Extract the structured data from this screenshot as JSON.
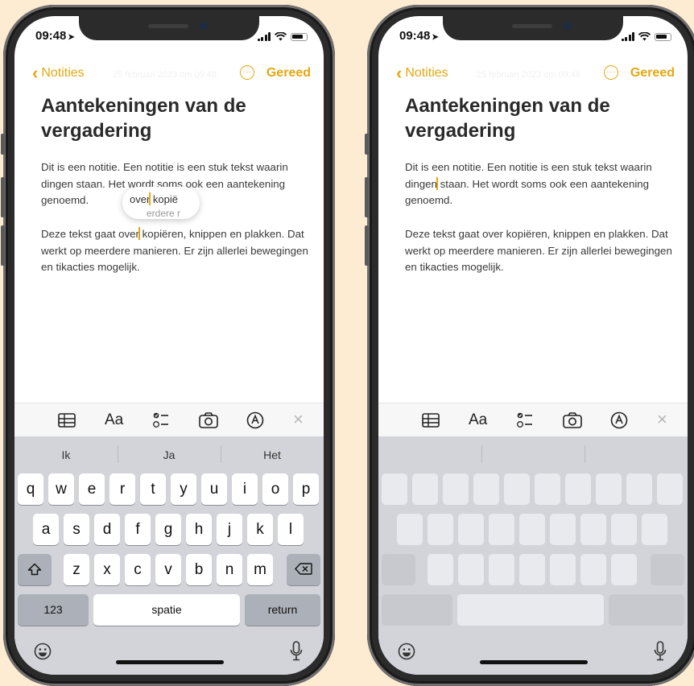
{
  "colors": {
    "accent": "#e6a710",
    "background": "#fdebd2"
  },
  "left_phone": {
    "status": {
      "time": "09:48",
      "location_icon": "location-arrow-icon"
    },
    "nav": {
      "back_label": "Notities",
      "faint_date": "25 februari 2023 om 09:48",
      "done_label": "Gereed"
    },
    "note": {
      "title": "Aantekeningen van de vergadering",
      "p1_a": "Dit is een notitie. Een notitie is een stuk tekst waarin dingen staan. Het wordt soms ook een aantekening ge",
      "p1_b": "noemd.",
      "p2_a": "Deze tekst gaat over",
      "p2_b": " kopiëren, knippen en plakken. Dat werkt op meerdere manieren. Er zijn allerlei bewegingen en tikacties mogelijk."
    },
    "magnifier": {
      "line1_a": "over",
      "line1_b": " kopië",
      "line2": "erdere r"
    },
    "toolbar": {
      "format_label": "Aa"
    },
    "suggestions": [
      "Ik",
      "Ja",
      "Het"
    ],
    "keys": {
      "row1": [
        "q",
        "w",
        "e",
        "r",
        "t",
        "y",
        "u",
        "i",
        "o",
        "p"
      ],
      "row2": [
        "a",
        "s",
        "d",
        "f",
        "g",
        "h",
        "j",
        "k",
        "l"
      ],
      "row3": [
        "z",
        "x",
        "c",
        "v",
        "b",
        "n",
        "m"
      ],
      "numbers": "123",
      "space": "spatie",
      "return": "return"
    }
  },
  "right_phone": {
    "status": {
      "time": "09:48"
    },
    "nav": {
      "back_label": "Notities",
      "faint_date": "25 februari 2023 om 09:48",
      "done_label": "Gereed"
    },
    "note": {
      "title": "Aantekeningen van de vergadering",
      "p1_a": "Dit is een notitie. Een notitie is een stuk tekst waarin dingen",
      "p1_b": " staan. Het wordt soms ook een aantekening genoemd.",
      "p2": "Deze tekst gaat over kopiëren, knippen en plakken. Dat werkt op meerdere manieren. Er zijn allerlei bewegingen en tikacties mogelijk."
    },
    "toolbar": {
      "format_label": "Aa"
    }
  }
}
